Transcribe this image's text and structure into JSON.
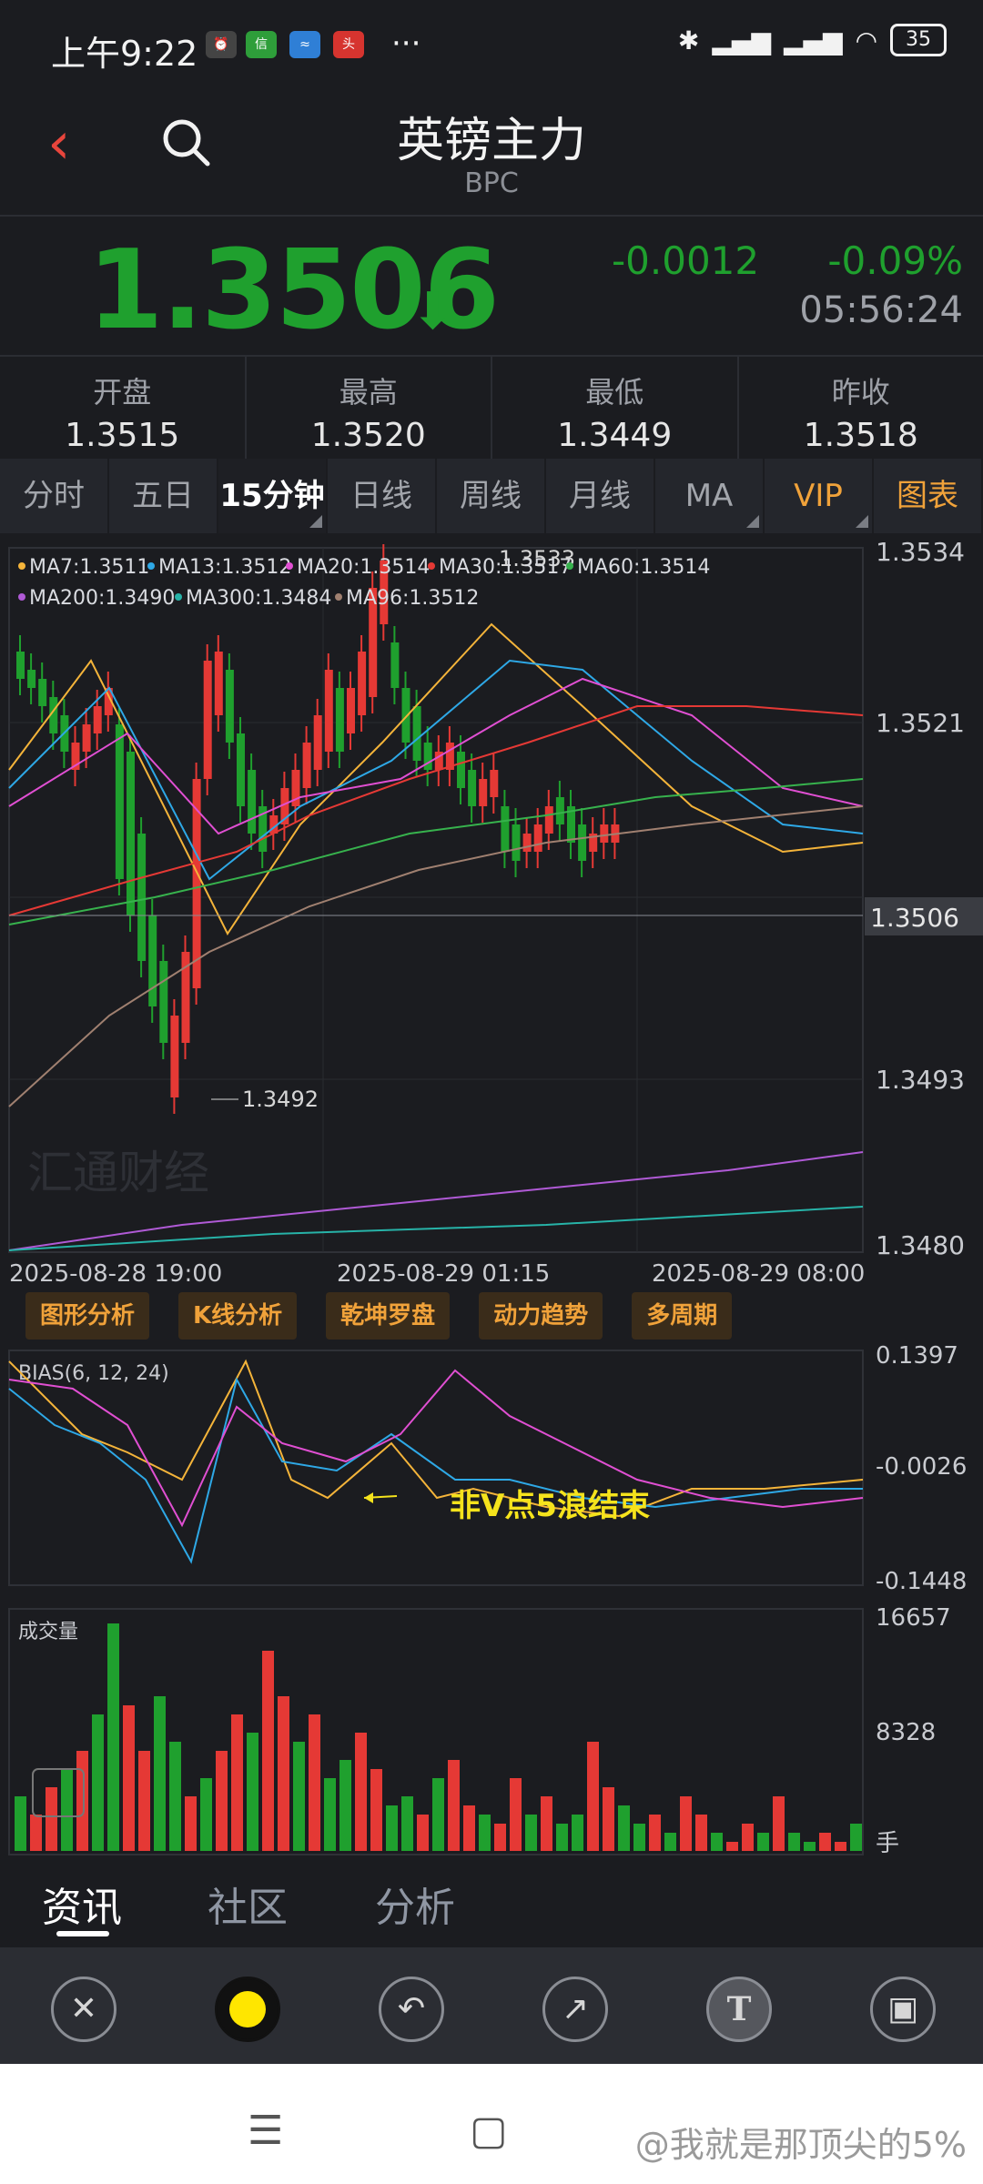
{
  "status_bar": {
    "time": "上午9:22",
    "battery": "35"
  },
  "header": {
    "title": "英镑主力",
    "subtitle": "BPC"
  },
  "quote": {
    "price": "1.3506",
    "change": "-0.0012",
    "change_pct": "-0.09%",
    "time": "05:56:24"
  },
  "stats": [
    {
      "label": "开盘",
      "value": "1.3515"
    },
    {
      "label": "最高",
      "value": "1.3520"
    },
    {
      "label": "最低",
      "value": "1.3449"
    },
    {
      "label": "昨收",
      "value": "1.3518"
    }
  ],
  "tabs": [
    "分时",
    "五日",
    "15分钟",
    "日线",
    "周线",
    "月线",
    "MA",
    "VIP",
    "图表"
  ],
  "chart": {
    "ma_legend": [
      {
        "text": "MA7:1.3511",
        "color": "#f4b43a"
      },
      {
        "text": "MA13:1.3512",
        "color": "#2ea8e6"
      },
      {
        "text": "MA20:1.3514",
        "color": "#e04fd2"
      },
      {
        "text": "MA30:1.3517",
        "color": "#e53935"
      },
      {
        "text": "MA60:1.3514",
        "color": "#37b24d"
      },
      {
        "text": "MA200:1.3490",
        "color": "#b05ad6"
      },
      {
        "text": "MA300:1.3484",
        "color": "#27b3a8"
      },
      {
        "text": "MA96:1.3512",
        "color": "#a08070"
      }
    ],
    "y_ticks": [
      "1.3534",
      "1.3521",
      "1.3493",
      "1.3480"
    ],
    "current_price_tag": "1.3506",
    "high_mark": "1.3533",
    "low_mark": "1.3492",
    "x_labels": [
      "2025-08-28 19:00",
      "2025-08-29 01:15",
      "2025-08-29 08:00"
    ],
    "watermark": "汇通财经"
  },
  "analysis_buttons": [
    "图形分析",
    "K线分析",
    "乾坤罗盘",
    "动力趋势",
    "多周期"
  ],
  "bias": {
    "title": "BIAS(6, 12, 24)",
    "ticks": [
      "0.1397",
      "-0.0026",
      "-0.1448"
    ],
    "annotation": "非V点5浪结束"
  },
  "volume": {
    "title": "成交量",
    "ticks": [
      "16657",
      "8328",
      "手"
    ]
  },
  "bottom_tabs": [
    "资讯",
    "社区",
    "分析"
  ],
  "watermark_text": "@我就是那顶尖的5%",
  "colors": {
    "up": "#e53935",
    "down": "#1fa02e",
    "accent": "#f0a23a"
  }
}
